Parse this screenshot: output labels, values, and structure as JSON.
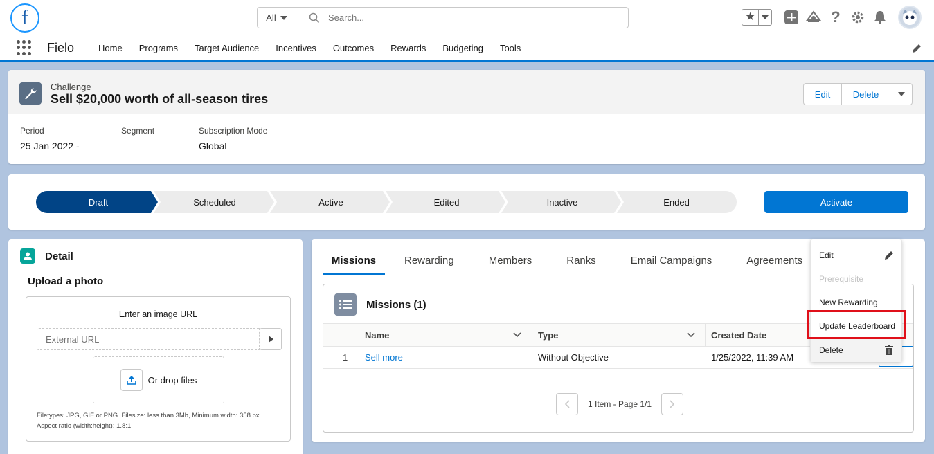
{
  "header": {
    "logo_letter": "f",
    "search_scope": "All",
    "search_placeholder": "Search...",
    "app_name": "Fielo",
    "nav_items": [
      "Home",
      "Programs",
      "Target Audience",
      "Incentives",
      "Outcomes",
      "Rewards",
      "Budgeting",
      "Tools"
    ],
    "icons": [
      "favorites-icon",
      "add-icon",
      "trailhead-icon",
      "help-icon",
      "setup-gear-icon",
      "notifications-bell-icon",
      "avatar"
    ]
  },
  "record": {
    "object_type": "Challenge",
    "title": "Sell $20,000 worth of all-season tires",
    "actions": {
      "edit": "Edit",
      "delete": "Delete"
    },
    "fields": [
      {
        "label": "Period",
        "value": "25 Jan 2022 -"
      },
      {
        "label": "Segment",
        "value": ""
      },
      {
        "label": "Subscription Mode",
        "value": "Global"
      }
    ]
  },
  "path": {
    "steps": [
      "Draft",
      "Scheduled",
      "Active",
      "Edited",
      "Inactive",
      "Ended"
    ],
    "current": "Draft",
    "activate_label": "Activate"
  },
  "detail": {
    "title": "Detail",
    "upload_title": "Upload a photo",
    "url_label": "Enter an image URL",
    "url_placeholder": "External URL",
    "drop_label": "Or drop files",
    "hint_line1": "Filetypes: JPG, GIF or PNG. Filesize: less than 3Mb, Minimum width: 358 px",
    "hint_line2": "Aspect ratio (width:height): 1.8:1"
  },
  "related": {
    "tabs": [
      "Missions",
      "Rewarding",
      "Members",
      "Ranks",
      "Email Campaigns",
      "Agreements"
    ],
    "active_tab": "Missions",
    "list_title": "Missions (1)",
    "columns": [
      "Name",
      "Type",
      "Created Date"
    ],
    "rows": [
      {
        "num": "1",
        "name": "Sell more",
        "type": "Without Objective",
        "created": "1/25/2022, 11:39 AM"
      }
    ],
    "pager_text": "1 Item - Page 1/1"
  },
  "menu": {
    "items": [
      {
        "label": "Edit",
        "disabled": false
      },
      {
        "label": "Prerequisite",
        "disabled": true
      },
      {
        "label": "New Rewarding",
        "disabled": false
      },
      {
        "label": "Update Leaderboard",
        "disabled": false,
        "highlighted": true
      },
      {
        "label": "Delete",
        "disabled": false
      }
    ],
    "highlight_color": "#e0101a"
  },
  "colors": {
    "brand": "#0176d3",
    "path_active": "#014486",
    "path_inactive": "#ececec"
  }
}
